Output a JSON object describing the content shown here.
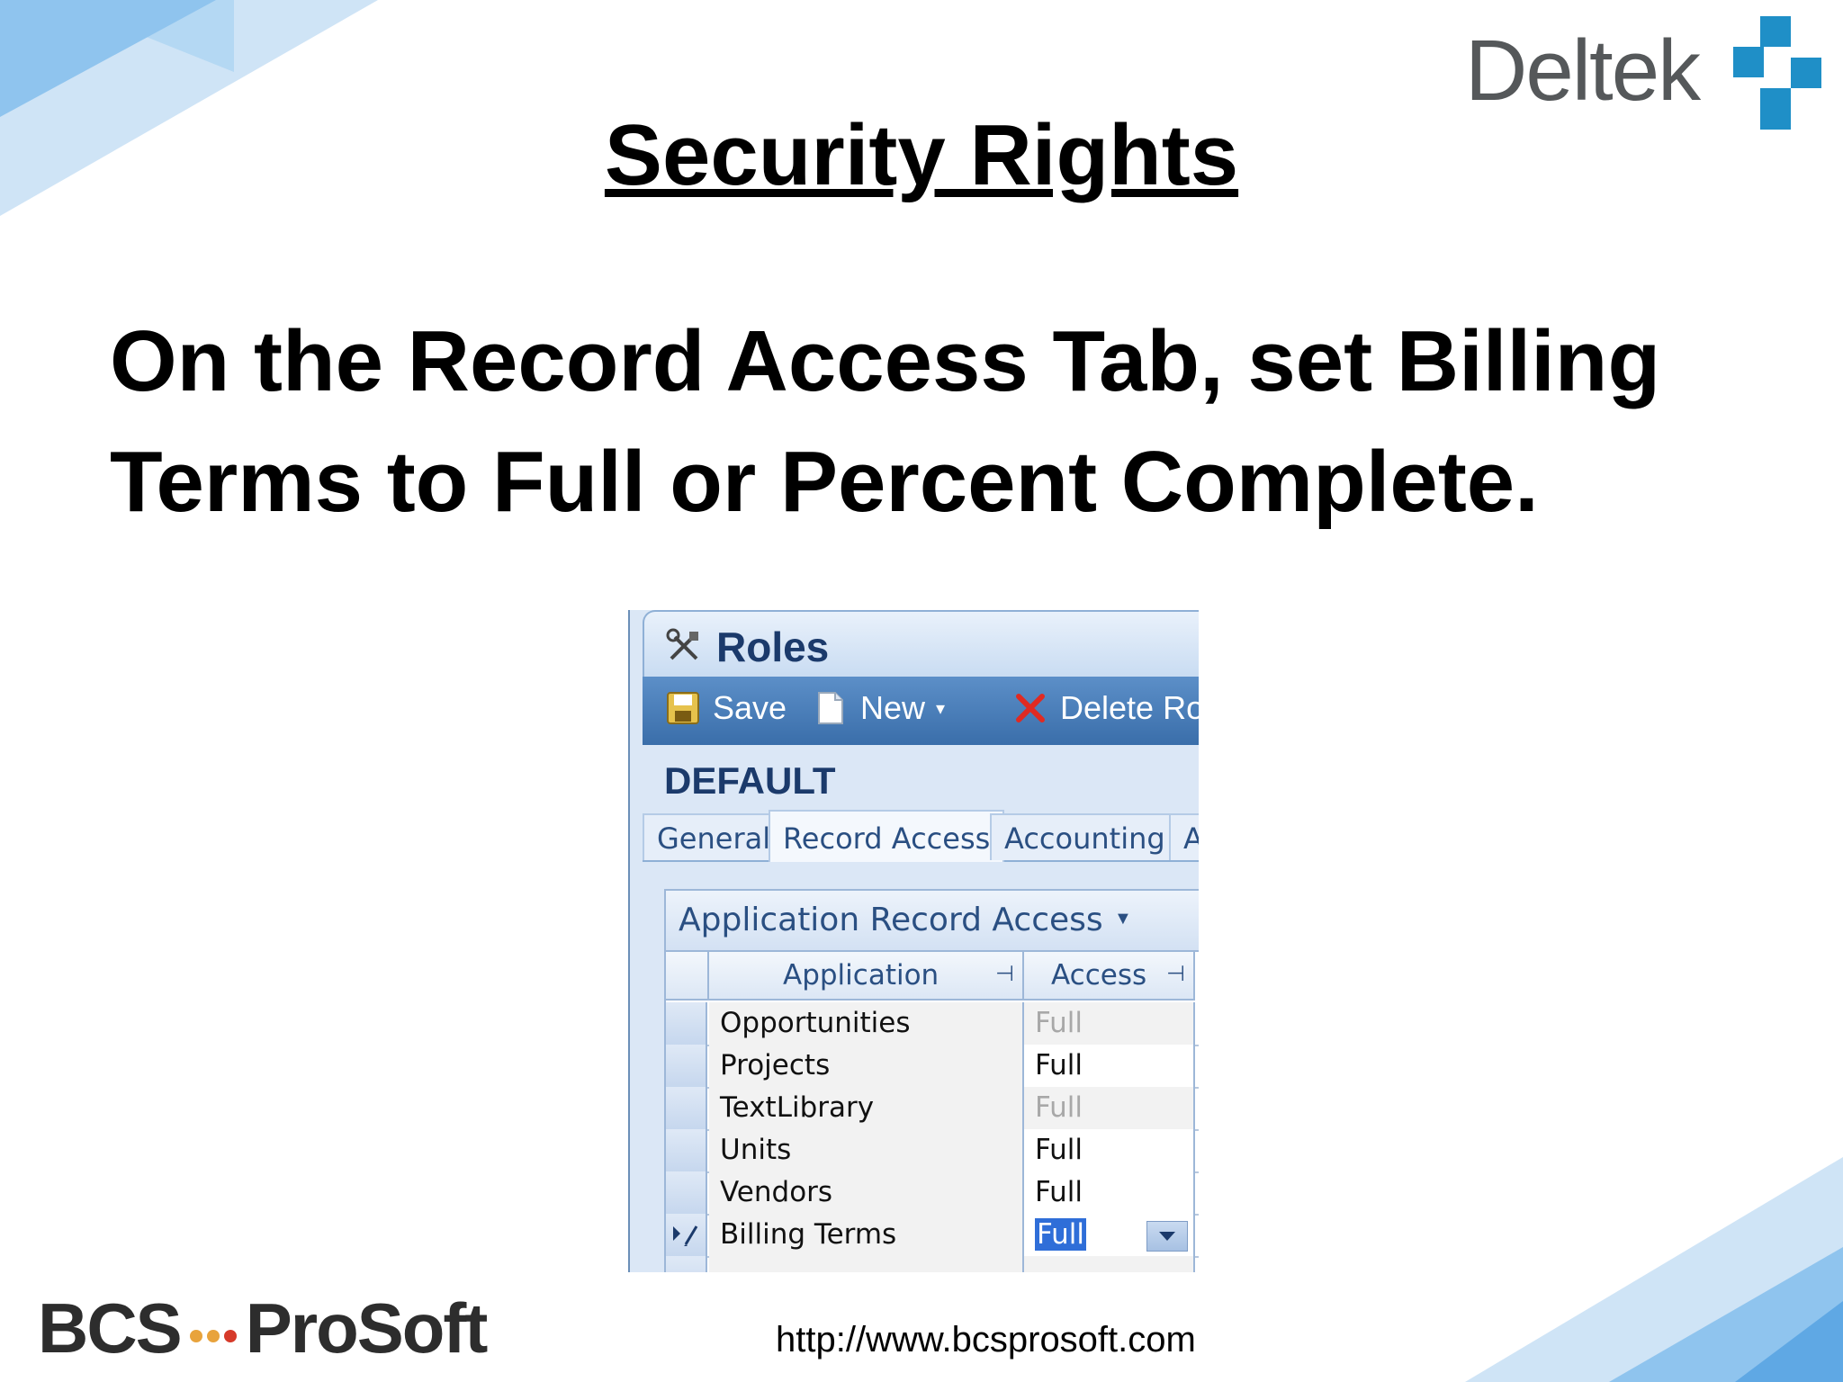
{
  "slide": {
    "title": "Security Rights",
    "body": "On the Record Access Tab, set Billing Terms to Full or Percent Complete.",
    "body_line1": "On the Record Access Tab, set Billing",
    "body_line2": "Terms to Full or Percent Complete.",
    "logo_text": "Deltek",
    "footer_brand_left": "BCS",
    "footer_brand_right": "ProSoft",
    "footer_url": "http://www.bcsprosoft.com"
  },
  "app": {
    "title": "Roles",
    "toolbar": {
      "save_label": "Save",
      "new_label": "New",
      "delete_label": "Delete Rol"
    },
    "role_name": "DEFAULT",
    "tabs": [
      {
        "label": "General",
        "active": false
      },
      {
        "label": "Record Access",
        "active": true
      },
      {
        "label": "Accounting",
        "active": false
      },
      {
        "label": "Ac",
        "active": false
      }
    ],
    "grid": {
      "title": "Application Record Access",
      "columns": [
        "Application",
        "Access"
      ],
      "rows": [
        {
          "application": "Opportunities",
          "access": "Full",
          "editable": false
        },
        {
          "application": "Projects",
          "access": "Full",
          "editable": true
        },
        {
          "application": "TextLibrary",
          "access": "Full",
          "editable": false
        },
        {
          "application": "Units",
          "access": "Full",
          "editable": true
        },
        {
          "application": "Vendors",
          "access": "Full",
          "editable": true
        },
        {
          "application": "Billing Terms",
          "access": "Full",
          "editable": true,
          "selected": true
        }
      ]
    }
  },
  "colors": {
    "accent_blue": "#3a6eaa",
    "deltek_blue": "#1f8fc7",
    "selection_blue": "#2f6ed8"
  }
}
